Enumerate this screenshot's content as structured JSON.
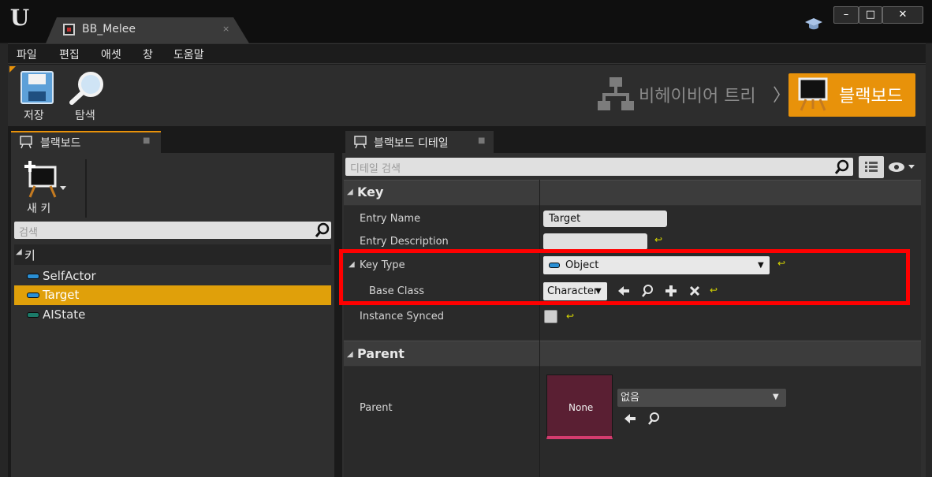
{
  "window": {
    "tab_title": "BB_Melee",
    "tab_close": "×",
    "minimize": "–",
    "maximize": "□",
    "close": "✕"
  },
  "menu": [
    "파일",
    "편집",
    "애셋",
    "창",
    "도움말"
  ],
  "toolbar": {
    "save_label": "저장",
    "browse_label": "탐색",
    "behavior_tree_label": "비헤이비어 트리",
    "breadcrumb_sep": "〉",
    "blackboard_label": "블랙보드"
  },
  "left_panel": {
    "tab_label": "블랙보드",
    "tab_pin": "■",
    "new_key_label": "새 키",
    "search_placeholder": "검색",
    "keys_header": "키",
    "keys": [
      {
        "label": "SelfActor",
        "color": "#2a8fd4",
        "selected": false
      },
      {
        "label": "Target",
        "color": "#2a8fd4",
        "selected": true
      },
      {
        "label": "AIState",
        "color": "#1b7a68",
        "selected": false
      }
    ]
  },
  "details_panel": {
    "tab_label": "블랙보드 디테일",
    "tab_pin": "■",
    "search_placeholder": "디테일 검색",
    "key_category": "Key",
    "parent_category": "Parent",
    "properties": {
      "entry_name_label": "Entry Name",
      "entry_name_value": "Target",
      "entry_description_label": "Entry Description",
      "entry_description_value": "",
      "key_type_label": "Key Type",
      "key_type_value": "Object",
      "base_class_label": "Base Class",
      "base_class_value": "Character",
      "instance_synced_label": "Instance Synced",
      "instance_synced_checked": false,
      "parent_label": "Parent",
      "parent_thumb_label": "None",
      "parent_value": "없음"
    },
    "reset_arrow": "↩"
  },
  "colors": {
    "accent": "#e8920a",
    "selection": "#e0a00a",
    "highlight": "#ff0000"
  }
}
